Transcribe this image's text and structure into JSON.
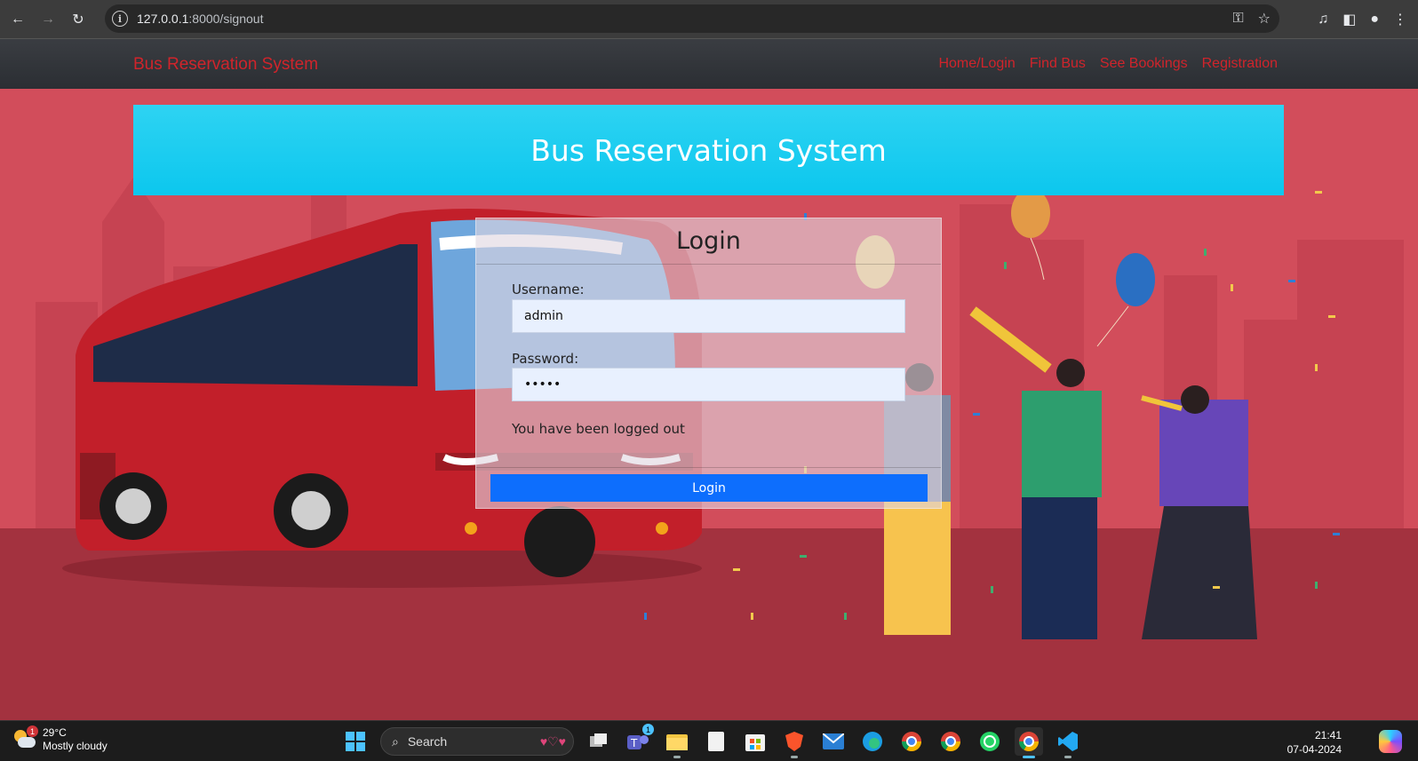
{
  "browser": {
    "url_host": "127.0.0.1",
    "url_path": ":8000/signout"
  },
  "navbar": {
    "brand": "Bus Reservation System",
    "links": [
      "Home/Login",
      "Find Bus",
      "See Bookings",
      "Registration"
    ]
  },
  "banner": {
    "title": "Bus Reservation System"
  },
  "login": {
    "heading": "Login",
    "username_label": "Username:",
    "username_value": "admin",
    "password_label": "Password:",
    "password_value": "•••••",
    "message": "You have been logged out",
    "button": "Login"
  },
  "taskbar": {
    "weather_temp": "29°C",
    "weather_desc": "Mostly cloudy",
    "weather_badge": "1",
    "search_label": "Search",
    "teams_badge": "1",
    "time": "21:41",
    "date": "07-04-2024"
  }
}
